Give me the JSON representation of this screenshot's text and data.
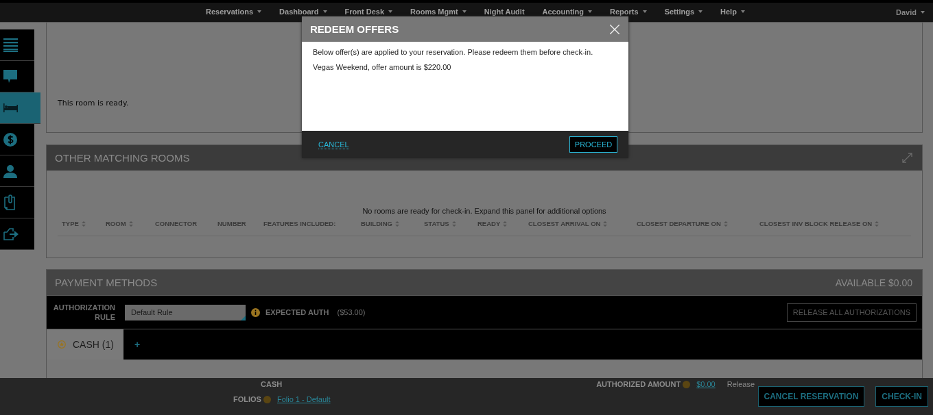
{
  "nav": {
    "items": [
      {
        "label": "Reservations",
        "has_menu": true
      },
      {
        "label": "Dashboard",
        "has_menu": true
      },
      {
        "label": "Front Desk",
        "has_menu": true
      },
      {
        "label": "Rooms Mgmt",
        "has_menu": true
      },
      {
        "label": "Night Audit",
        "has_menu": false
      },
      {
        "label": "Accounting",
        "has_menu": true
      },
      {
        "label": "Reports",
        "has_menu": true
      },
      {
        "label": "Settings",
        "has_menu": true
      },
      {
        "label": "Help",
        "has_menu": true
      }
    ],
    "user": {
      "label": "David",
      "has_menu": true
    }
  },
  "sidebar": {
    "items": [
      {
        "kind": "menu",
        "selected": false
      },
      {
        "kind": "chat",
        "selected": false
      },
      {
        "kind": "bed",
        "selected": true
      },
      {
        "kind": "dollar",
        "selected": false
      },
      {
        "kind": "person",
        "selected": false
      },
      {
        "kind": "clipboard",
        "selected": false
      },
      {
        "kind": "exit",
        "selected": false
      }
    ]
  },
  "room_panel": {
    "message": "This room is ready."
  },
  "matching_rooms": {
    "title": "OTHER MATCHING ROOMS",
    "notice": "No rooms are ready for check-in. Expand this panel for additional options",
    "columns": [
      {
        "label": "TYPE",
        "sortable": true
      },
      {
        "label": "ROOM",
        "sortable": true
      },
      {
        "label": "CONNECTOR",
        "sortable": false
      },
      {
        "label": "NUMBER",
        "sortable": false
      },
      {
        "label": "FEATURES INCLUDED:",
        "sortable": false
      },
      {
        "label": "BUILDING",
        "sortable": true
      },
      {
        "label": "STATUS",
        "sortable": true
      },
      {
        "label": "READY",
        "sortable": true
      },
      {
        "label": "CLOSEST ARRIVAL ON",
        "sortable": true
      },
      {
        "label": "CLOSEST DEPARTURE ON",
        "sortable": true
      },
      {
        "label": "CLOSEST INV BLOCK RELEASE ON",
        "sortable": true
      }
    ]
  },
  "payment": {
    "title": "PAYMENT METHODS",
    "available": "AVAILABLE $0.00",
    "auth_rule_label": "AUTHORIZATION RULE",
    "auth_rule_value": "Default Rule",
    "expected_auth_label": "EXPECTED AUTH",
    "expected_auth_value": "($53.00)",
    "release_all_button": "RELEASE ALL AUTHORIZATIONS",
    "tabs": [
      {
        "label": "CASH (1)",
        "selected": true
      }
    ],
    "add_tab": "+",
    "method_name": "CASH",
    "folios_label": "FOLIOS",
    "folio_link": "Folio 1 - Default",
    "authorized_amount_label": "AUTHORIZED AMOUNT",
    "authorized_amount": "$0.00",
    "release_link": "Release"
  },
  "actions": [
    "CANCEL RESERVATION",
    "CHECK-IN"
  ],
  "dialog": {
    "title": "REDEEM OFFERS",
    "lines": [
      "Below offer(s) are applied to your reservation. Please redeem them before check-in.",
      "Vegas Weekend, offer amount is $220.00"
    ],
    "cancel": "CANCEL",
    "proceed": "PROCEED"
  }
}
